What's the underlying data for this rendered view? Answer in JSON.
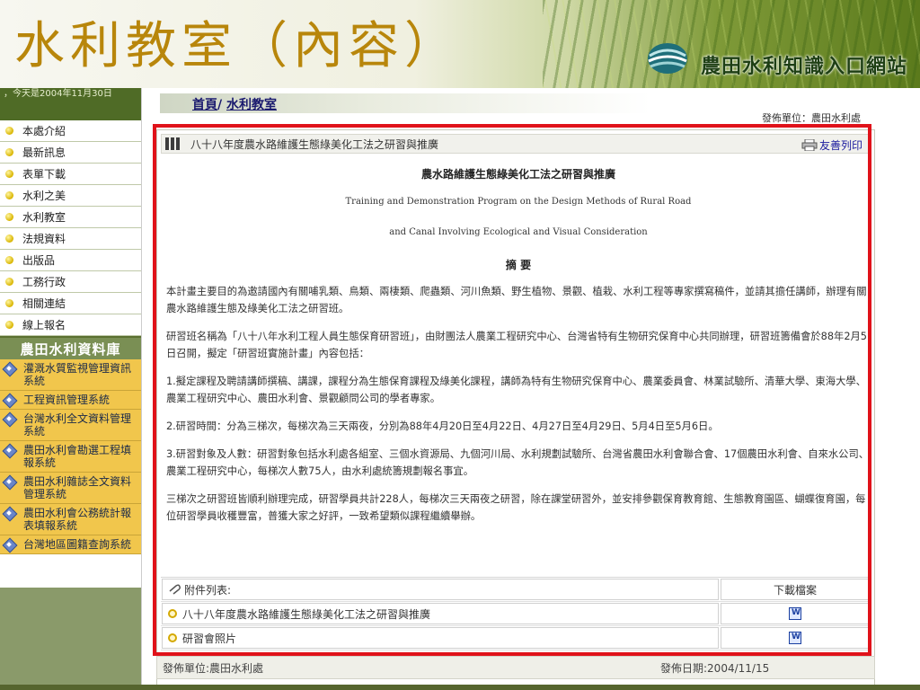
{
  "slide": {
    "title": "水利教室（內容）",
    "site_name": "農田水利知識入口網站"
  },
  "sidebar": {
    "today": "，今天是2004年11月30日",
    "items": [
      {
        "label": "本處介紹"
      },
      {
        "label": "最新訊息"
      },
      {
        "label": "表單下載"
      },
      {
        "label": "水利之美"
      },
      {
        "label": "水利教室"
      },
      {
        "label": "法規資料"
      },
      {
        "label": "出版品"
      },
      {
        "label": "工務行政"
      },
      {
        "label": "相關連結"
      },
      {
        "label": "線上報名"
      }
    ],
    "db_title": "農田水利資料庫",
    "db_items": [
      {
        "label": "灌溉水質監視管理資訊系統"
      },
      {
        "label": "工程資訊管理系統"
      },
      {
        "label": "台灣水利全文資料管理系統"
      },
      {
        "label": "農田水利會勘選工程填報系統"
      },
      {
        "label": "農田水利雜誌全文資料管理系統"
      },
      {
        "label": "農田水利會公務統計報表填報系統"
      },
      {
        "label": "台灣地區圖籍查詢系統"
      }
    ]
  },
  "breadcrumb": {
    "home": "首頁",
    "separator": "/",
    "current": "水利教室"
  },
  "top_publisher": "發佈單位：農田水利處",
  "article": {
    "header_title": "八十八年度農水路維護生態綠美化工法之研習與推廣",
    "print_label": "友善列印",
    "title": "農水路維護生態綠美化工法之研習與推廣",
    "english_line1": "Training and Demonstration Program on the Design Methods of Rural Road",
    "english_line2": "and Canal Involving Ecological and Visual Consideration",
    "abstract_heading": "摘 要",
    "paragraphs": [
      "本計畫主要目的為邀請國內有關哺乳類、鳥類、兩棲類、爬蟲類、河川魚類、野生植物、景觀、植栽、水利工程等專家撰寫稿件，並請其擔任講師，辦理有關農水路維護生態及綠美化工法之研習班。",
      "研習班名稱為「八十八年水利工程人員生態保育研習班」，由財團法人農業工程研究中心、台灣省特有生物研究保育中心共同辦理，研習班籌備會於88年2月5日召開，擬定「研習班實施計畫」內容包括：",
      "1.擬定課程及聘請講師撰稿、講課，課程分為生態保育課程及綠美化課程，講師為特有生物研究保育中心、農業委員會、林業試驗所、清華大學、東海大學、農業工程研究中心、農田水利會、景觀顧問公司的學者專家。",
      "2.研習時間：分為三梯次，每梯次為三天兩夜，分別為88年4月20日至4月22日、4月27日至4月29日、5月4日至5月6日。",
      "3.研習對象及人數：研習對象包括水利處各組室、三個水資源局、九個河川局、水利規劃試驗所、台灣省農田水利會聯合會、17個農田水利會、自來水公司、農業工程研究中心，每梯次人數75人，由水利處統籌規劃報名事宜。",
      "三梯次之研習班皆順利辦理完成，研習學員共計228人，每梯次三天兩夜之研習，除在課堂研習外，並安排參觀保育教育館、生態教育園區、蝴蝶復育園，每位研習學員收穫豐富，普獲大家之好評，一致希望類似課程繼續舉辦。"
    ]
  },
  "attachments": {
    "header_label": "附件列表:",
    "download_header": "下載檔案",
    "items": [
      {
        "name": "八十八年度農水路維護生態綠美化工法之研習與推廣",
        "icon": "word-doc-icon"
      },
      {
        "name": "研習會照片",
        "icon": "word-doc-icon"
      }
    ]
  },
  "footer": {
    "publisher": "發佈單位:農田水利處",
    "date": "發佈日期:2004/11/15"
  },
  "colors": {
    "title_gold": "#b8860b",
    "highlight_red": "#e0121a",
    "sidebar_green": "#4f6b26",
    "db_yellow": "#f1c64c"
  }
}
